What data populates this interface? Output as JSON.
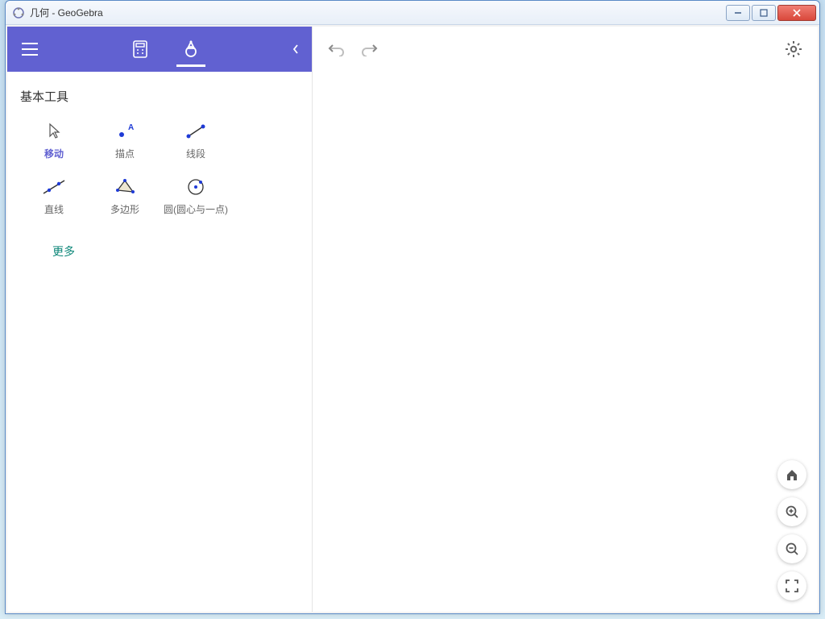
{
  "window": {
    "title": "几何 - GeoGebra"
  },
  "sidebar": {
    "section_title": "基本工具",
    "more_label": "更多",
    "tools": [
      {
        "id": "move",
        "label": "移动",
        "selected": true
      },
      {
        "id": "point",
        "label": "描点",
        "selected": false
      },
      {
        "id": "segment",
        "label": "线段",
        "selected": false
      },
      {
        "id": "line",
        "label": "直线",
        "selected": false
      },
      {
        "id": "polygon",
        "label": "多边形",
        "selected": false
      },
      {
        "id": "circle",
        "label": "圆(圆心与一点)",
        "selected": false
      }
    ]
  },
  "colors": {
    "accent": "#6161d1",
    "tool_blue": "#1f3bd6",
    "teal": "#0c8678"
  }
}
